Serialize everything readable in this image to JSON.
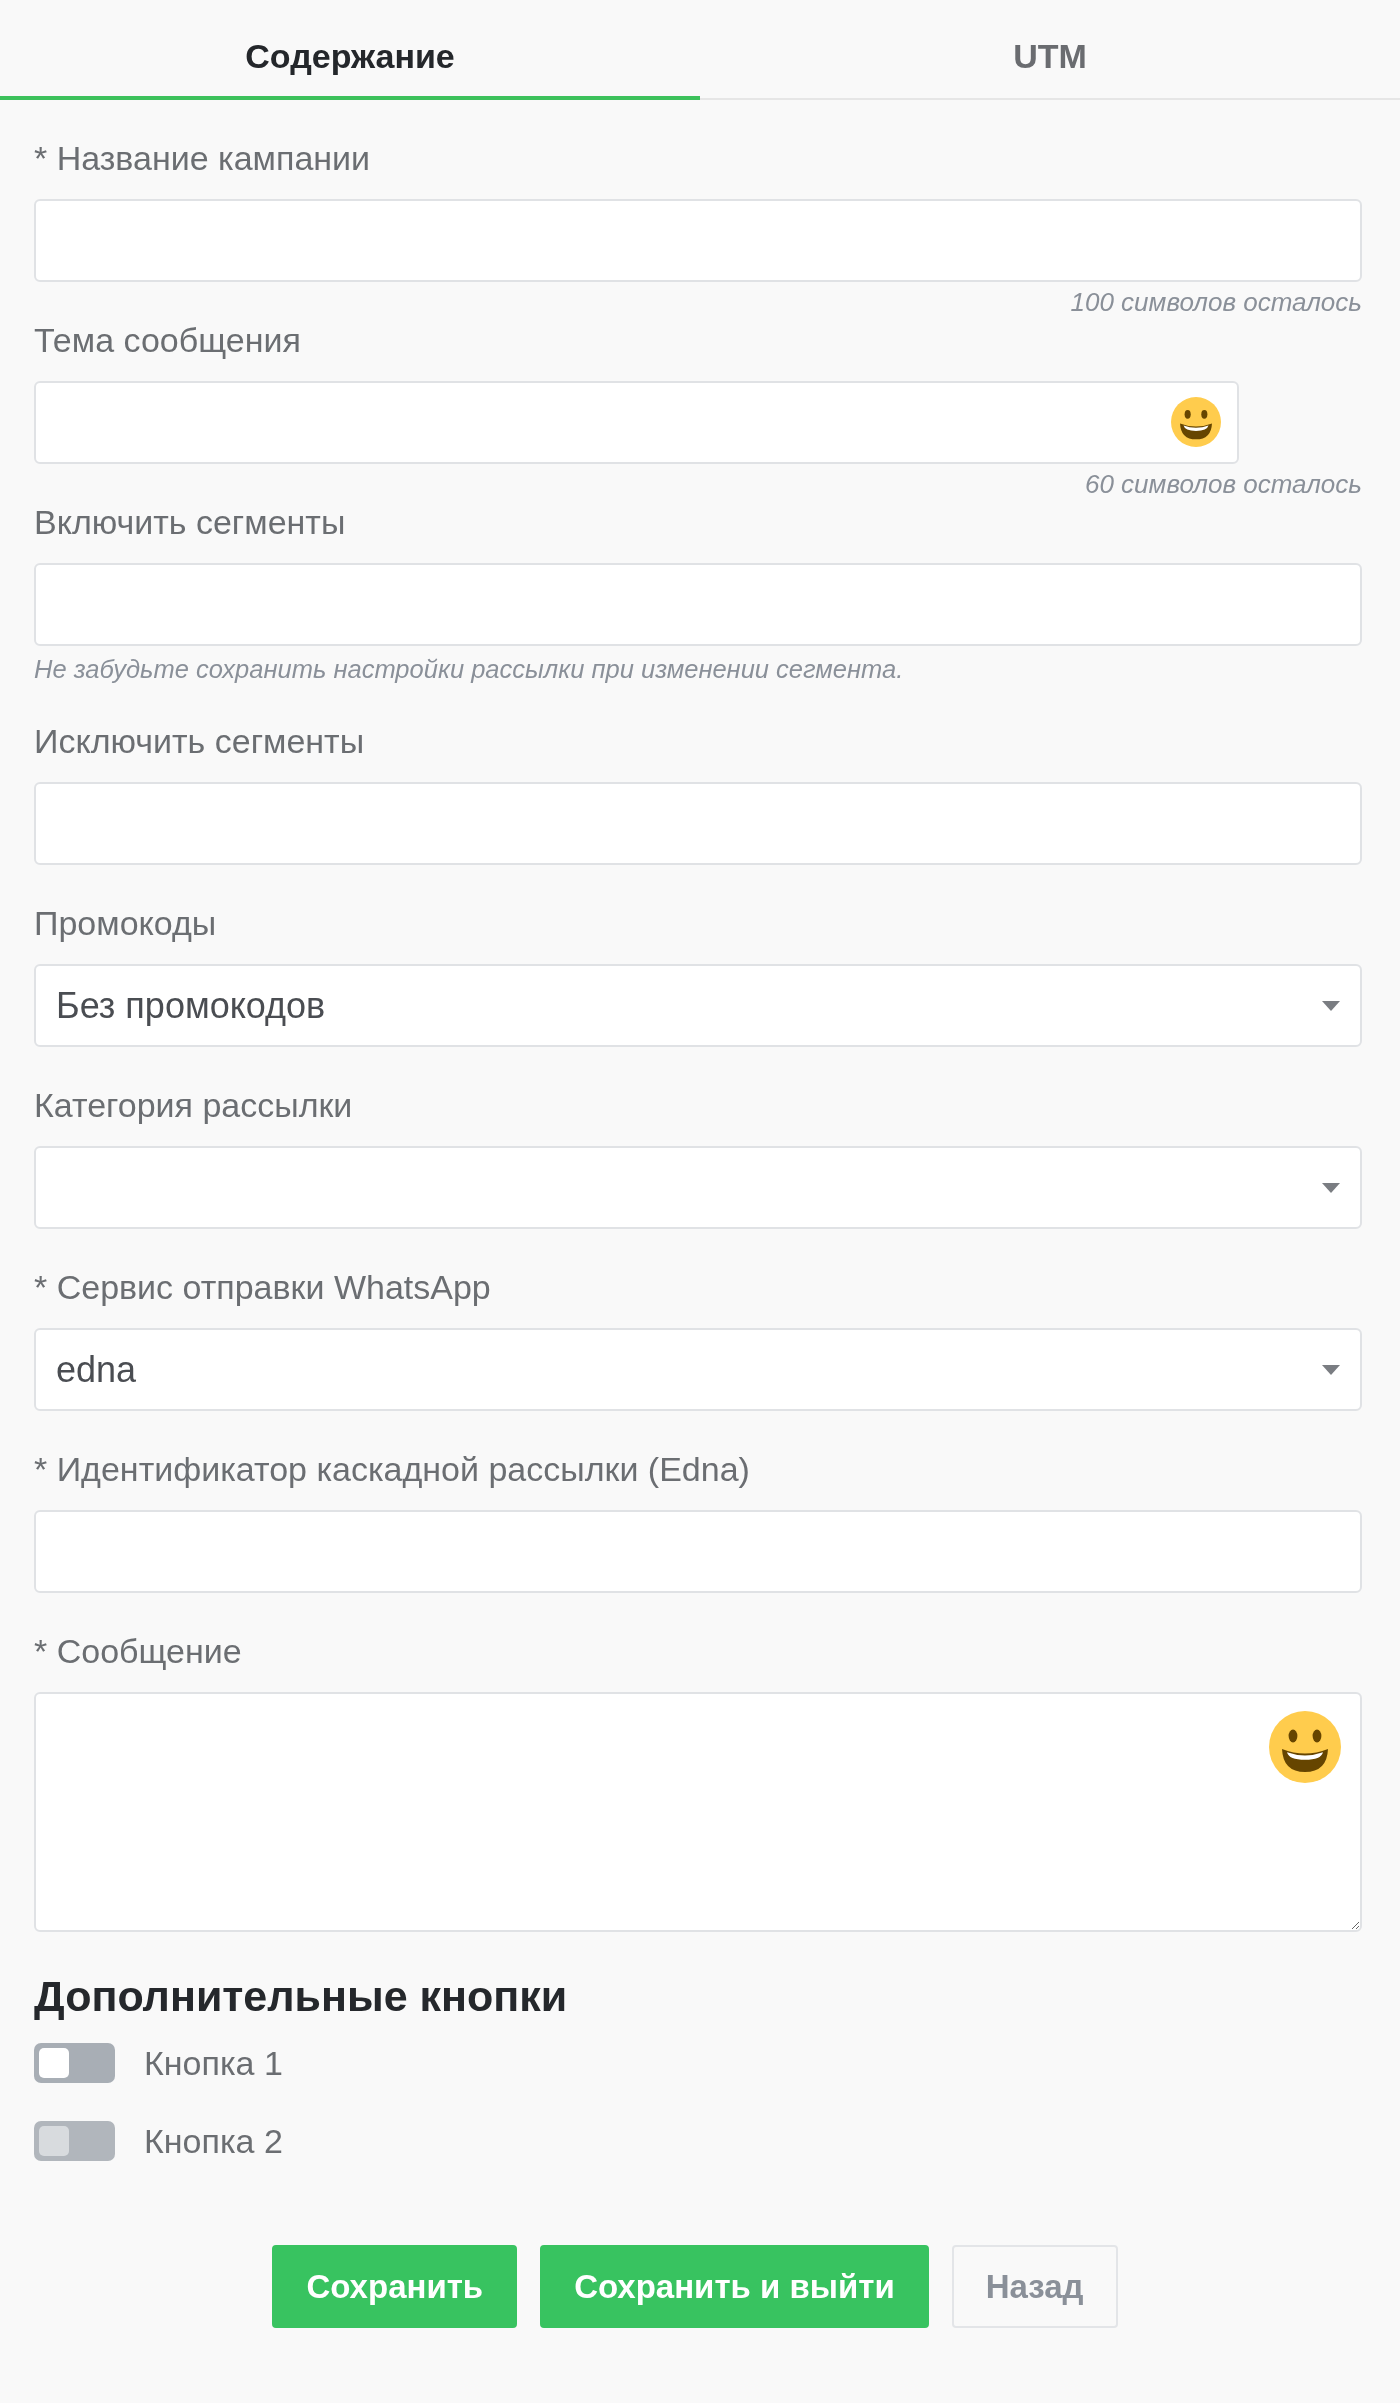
{
  "tabs": [
    {
      "label": "Содержание",
      "selected": true
    },
    {
      "label": "UTM",
      "selected": false
    }
  ],
  "fields": [
    {
      "kind": "input",
      "label": "* Название кампании",
      "emoji_button": false,
      "counter": "100 символов осталось"
    },
    {
      "kind": "input",
      "label": "Тема сообщения",
      "emoji_button": true,
      "counter": "60 символов осталось"
    },
    {
      "kind": "input",
      "label": "Включить сегменты",
      "emoji_button": false,
      "help": "Не забудьте сохранить настройки рассылки при изменении сегмента."
    },
    {
      "kind": "input",
      "label": "Исключить сегменты",
      "emoji_button": false
    },
    {
      "kind": "select",
      "label": "Промокоды",
      "emoji_button": false,
      "value": "Без промокодов"
    },
    {
      "kind": "select",
      "label": "Категория рассылки",
      "emoji_button": false
    },
    {
      "kind": "select",
      "label": "* Сервис отправки WhatsApp",
      "emoji_button": false,
      "value": "edna"
    },
    {
      "kind": "input",
      "label": "* Идентификатор каскадной рассылки (Edna)",
      "emoji_button": false
    },
    {
      "kind": "textarea",
      "label": "* Сообщение",
      "emoji_button": true
    }
  ],
  "extra_buttons": {
    "title": "Дополнительные кнопки",
    "toggles": [
      {
        "label": "Кнопка 1",
        "on": false,
        "disabled": false
      },
      {
        "label": "Кнопка 2",
        "on": false,
        "disabled": true
      }
    ]
  },
  "actions": [
    {
      "label": "Сохранить",
      "kind": "primary"
    },
    {
      "label": "Сохранить и выйти",
      "kind": "primary"
    },
    {
      "label": "Назад",
      "kind": "secondary"
    }
  ]
}
